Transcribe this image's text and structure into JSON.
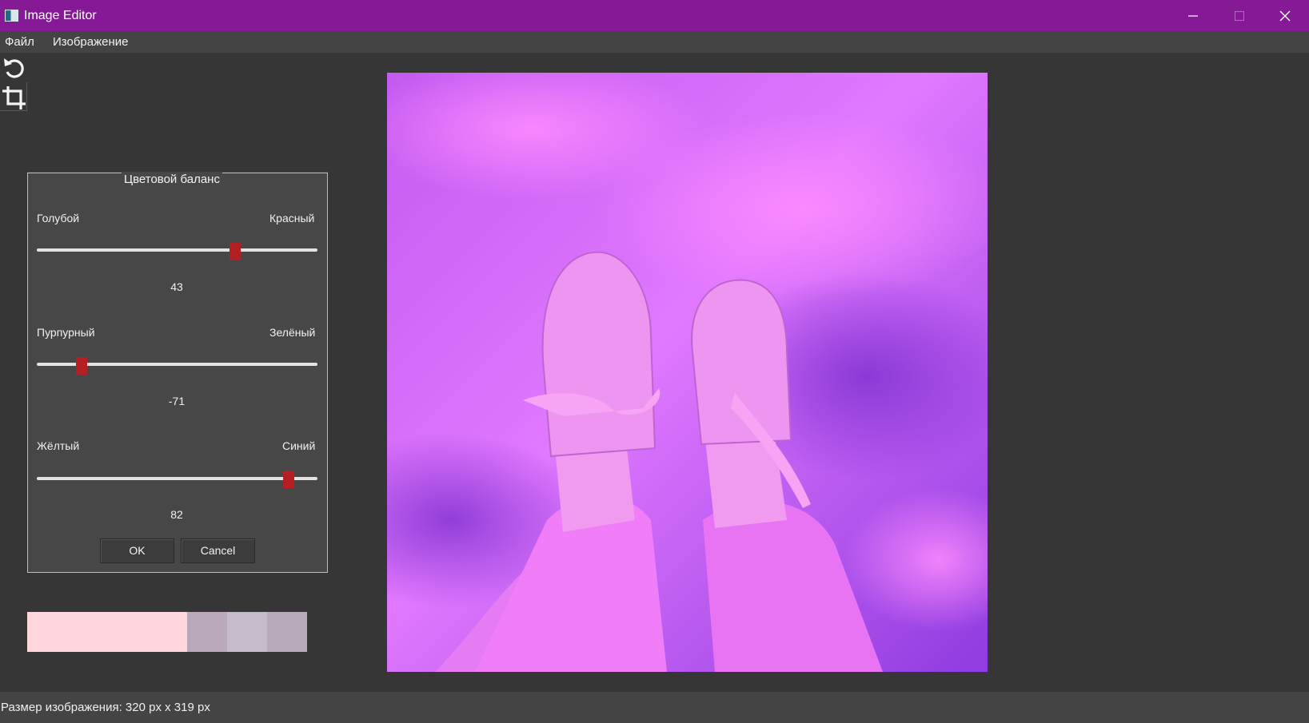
{
  "window": {
    "title": "Image Editor",
    "accent": "#861a96"
  },
  "menu": {
    "items": [
      "Файл",
      "Изображение"
    ]
  },
  "toolbar": {
    "tools": [
      {
        "icon": "rotate-icon"
      },
      {
        "icon": "crop-icon"
      }
    ]
  },
  "color_balance": {
    "title": "Цветовой баланс",
    "sliders": [
      {
        "left": "Голубой",
        "right": "Красный",
        "value": "43"
      },
      {
        "left": "Пурпурный",
        "right": "Зелёный",
        "value": "-71"
      },
      {
        "left": "Жёлтый",
        "right": "Синий",
        "value": "82"
      }
    ],
    "ok_label": "OK",
    "cancel_label": "Cancel",
    "thumb_color": "#b51f24"
  },
  "palette": {
    "colors": [
      "#ffd7dc",
      "#ffd7dc",
      "#ffd7dc",
      "#ffd7dc",
      "#b9a9bb",
      "#c6bbc9",
      "#b9aabb"
    ]
  },
  "image": {
    "tint": "#b449e6"
  },
  "statusbar": {
    "text": "Размер изображения: 320 px x 319 px"
  }
}
